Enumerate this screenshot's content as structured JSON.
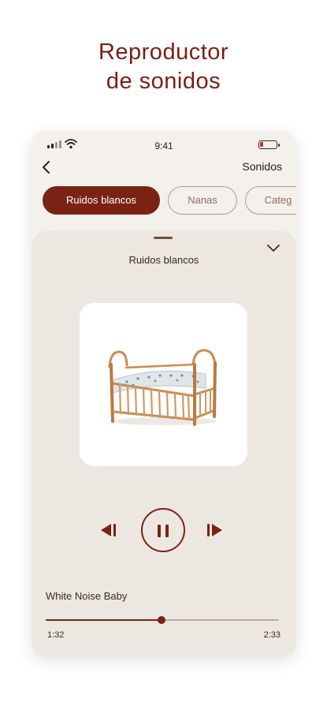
{
  "headline": {
    "line1": "Reproductor",
    "line2": "de sonidos"
  },
  "status_bar": {
    "time": "9:41",
    "battery_level": 0.2,
    "icons": [
      "signal-icon",
      "wifi-icon",
      "battery-icon"
    ]
  },
  "topbar": {
    "back_icon": "chevron-left-icon",
    "title": "Sonidos"
  },
  "tabs": [
    {
      "label": "Ruidos blancos",
      "active": true
    },
    {
      "label": "Nanas",
      "active": false
    },
    {
      "label": "Categ",
      "active": false
    }
  ],
  "player": {
    "sheet_title": "Ruidos blancos",
    "collapse_icon": "chevron-down-icon",
    "artwork": "crib-illustration",
    "track_title": "White Noise Baby",
    "current_time": "1:32",
    "total_time": "2:33",
    "progress": 0.497,
    "controls": [
      "skip-previous-icon",
      "pause-icon",
      "skip-next-icon"
    ]
  },
  "colors": {
    "accent": "#7a2314",
    "headline": "#7a1f14",
    "background": "#f4f0ec",
    "sheet": "#ede7e1"
  }
}
